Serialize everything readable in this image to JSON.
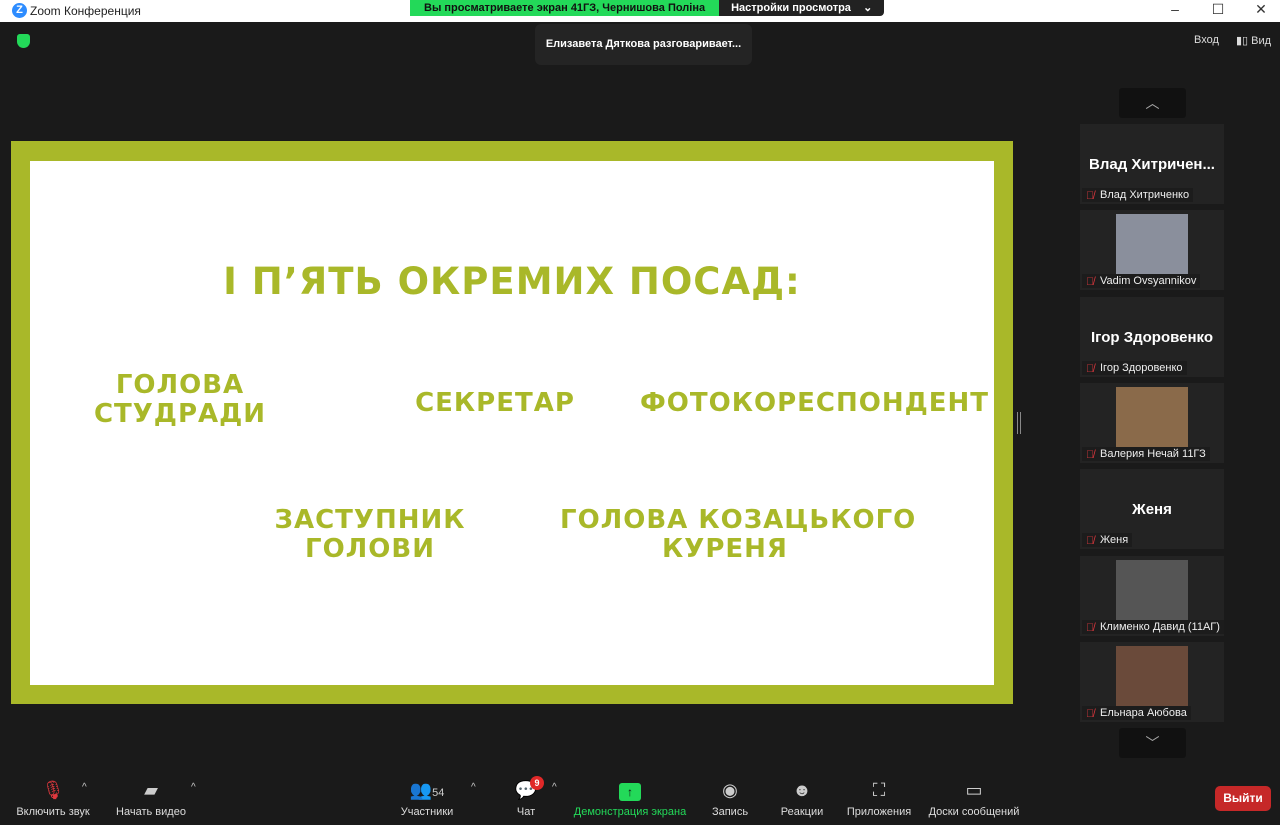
{
  "window": {
    "title": "Zoom Конференция",
    "logo": "Z",
    "minimize": "–",
    "maximize": "☐",
    "close": "✕"
  },
  "banner": {
    "viewing": "Вы просматриваете экран 41ГЗ, Чернишова Поліна",
    "settings": "Настройки просмотра",
    "chevron": "⌄"
  },
  "talking": "Елизавета Дяткова разговаривает...",
  "top_right": {
    "enter": "Вход",
    "view": "Вид"
  },
  "slide": {
    "title": "І П’ЯТЬ ОКРЕМИХ ПОСАД:",
    "items": [
      "ГОЛОВА\nСТУДРАДИ",
      "СЕКРЕТАР",
      "ФОТОКОРЕСПОНДЕНТ",
      "ЗАСТУПНИК\nГОЛОВИ",
      "ГОЛОВА КОЗАЦЬКОГО\nКУРЕНЯ"
    ],
    "accent": "#a9b829"
  },
  "participants": [
    {
      "big": "Влад  Хитричен...",
      "name": "Влад Хитриченко",
      "video": false
    },
    {
      "name": "Vadim Ovsyannikov",
      "video": true,
      "color": "#8a8f9c"
    },
    {
      "big": "Ігор Здоровенко",
      "name": "Ігор Здоровенко",
      "video": false
    },
    {
      "name": "Валерия Нечай 11ГЗ",
      "video": true,
      "color": "#8a6a4a"
    },
    {
      "big": "Женя",
      "name": "Женя",
      "video": false
    },
    {
      "name": "Клименко Давид (11АГ)",
      "video": true,
      "color": "#555"
    },
    {
      "name": "Ельнара Аюбова",
      "video": true,
      "color": "#6a4a3a"
    }
  ],
  "toolbar": {
    "unmute": "Включить звук",
    "video": "Начать видео",
    "participants": "Участники",
    "participants_count": "54",
    "chat": "Чат",
    "chat_badge": "9",
    "share": "Демонстрация экрана",
    "record": "Запись",
    "reactions": "Реакции",
    "apps": "Приложения",
    "whiteboards": "Доски сообщений",
    "leave": "Выйти"
  },
  "colors": {
    "share": "#23d959",
    "leave": "#c62828"
  }
}
